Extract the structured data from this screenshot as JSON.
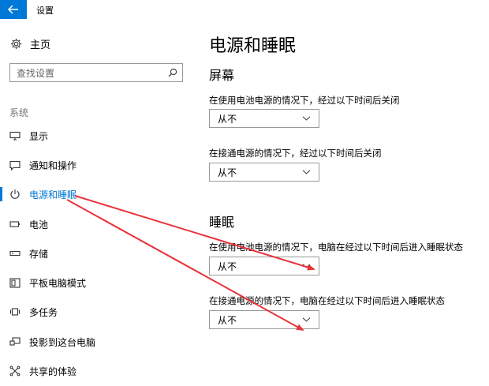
{
  "window": {
    "title": "设置"
  },
  "sidebar": {
    "home_label": "主页",
    "search_placeholder": "查找设置",
    "section_label": "系统",
    "items": [
      {
        "label": "显示",
        "icon": "monitor-icon"
      },
      {
        "label": "通知和操作",
        "icon": "notification-icon"
      },
      {
        "label": "电源和睡眠",
        "icon": "power-icon",
        "active": true
      },
      {
        "label": "电池",
        "icon": "battery-icon"
      },
      {
        "label": "存储",
        "icon": "storage-icon"
      },
      {
        "label": "平板电脑模式",
        "icon": "tablet-mode-icon"
      },
      {
        "label": "多任务",
        "icon": "multitasking-icon"
      },
      {
        "label": "投影到这台电脑",
        "icon": "project-icon"
      },
      {
        "label": "共享的体验",
        "icon": "shared-experiences-icon"
      }
    ]
  },
  "main": {
    "title": "电源和睡眠",
    "screen": {
      "heading": "屏幕",
      "battery_label": "在使用电池电源的情况下，经过以下时间后关闭",
      "battery_value": "从不",
      "plugged_label": "在接通电源的情况下，经过以下时间后关闭",
      "plugged_value": "从不"
    },
    "sleep": {
      "heading": "睡眠",
      "battery_label": "在使用电池电源的情况下，电脑在经过以下时间后进入睡眠状态",
      "battery_value": "从不",
      "plugged_label": "在接通电源的情况下，电脑在经过以下时间后进入睡眠状态",
      "plugged_value": "从不"
    }
  },
  "colors": {
    "accent": "#0078d7",
    "annotation": "#e8333b"
  }
}
